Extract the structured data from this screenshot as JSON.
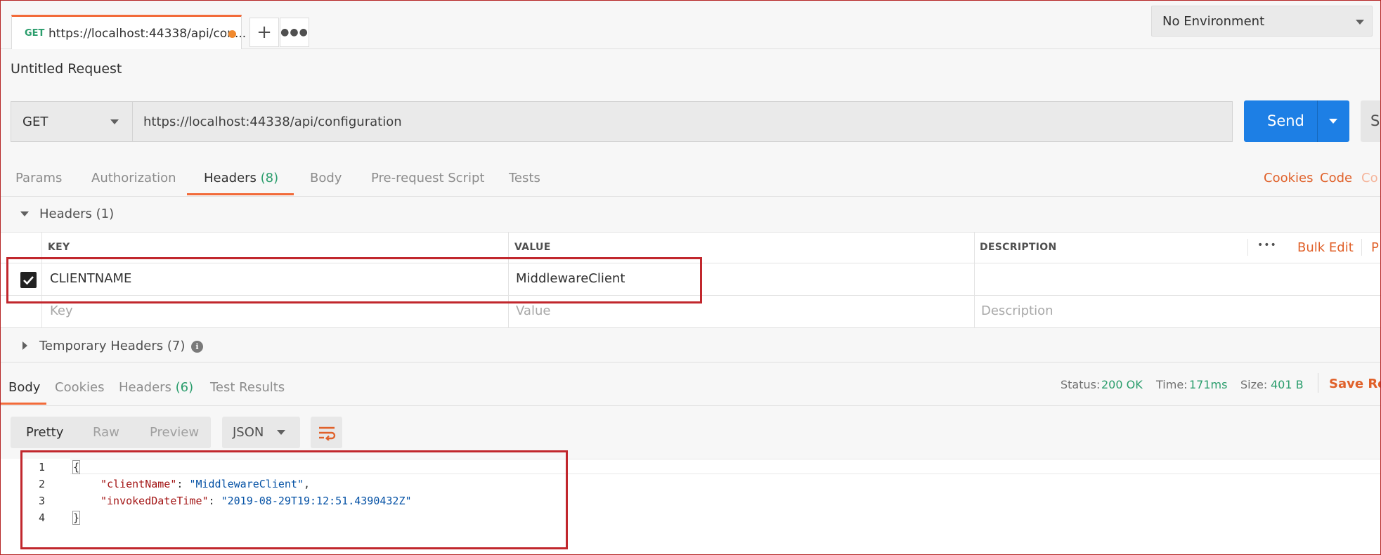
{
  "request_tab": {
    "method": "GET",
    "url": "https://localhost:44338/api/con..."
  },
  "environment": {
    "selected": "No Environment"
  },
  "request": {
    "title": "Untitled Request",
    "method": "GET",
    "url": "https://localhost:44338/api/configuration",
    "send_label": "Send",
    "save_label": "Sa"
  },
  "request_tabs": {
    "params": "Params",
    "authorization": "Authorization",
    "headers": "Headers",
    "headers_count": "(8)",
    "body": "Body",
    "pre_request": "Pre-request Script",
    "tests": "Tests",
    "cookies": "Cookies",
    "code": "Code",
    "comments": "Co"
  },
  "headers_section": {
    "title": "Headers",
    "count": "(1)",
    "col_key": "KEY",
    "col_value": "VALUE",
    "col_description": "DESCRIPTION",
    "more": "•••",
    "bulk_edit": "Bulk Edit",
    "presets": "P",
    "rows": [
      {
        "key": "CLIENTNAME",
        "value": "MiddlewareClient",
        "description": ""
      }
    ],
    "placeholder": {
      "key": "Key",
      "value": "Value",
      "description": "Description"
    }
  },
  "temporary_headers": {
    "title": "Temporary Headers",
    "count": "(7)",
    "info": "i"
  },
  "response": {
    "tabs": {
      "body": "Body",
      "cookies": "Cookies",
      "headers": "Headers",
      "headers_count": "(6)",
      "test_results": "Test Results"
    },
    "status_label": "Status:",
    "status_value": "200 OK",
    "time_label": "Time:",
    "time_value": "171ms",
    "size_label": "Size:",
    "size_value": "401 B",
    "save_response": "Save Res",
    "formats": {
      "pretty": "Pretty",
      "raw": "Raw",
      "preview": "Preview"
    },
    "language": "JSON",
    "code": {
      "line_numbers": [
        "1",
        "2",
        "3",
        "4"
      ],
      "open_brace": "{",
      "close_brace": "}",
      "key1": "\"clientName\"",
      "val1": "\"MiddlewareClient\"",
      "key2": "\"invokedDateTime\"",
      "val2": "\"2019-08-29T19:12:51.4390432Z\"",
      "colon": ": ",
      "comma": ","
    }
  },
  "colors": {
    "accent": "#f26b3a",
    "send": "#1d7fe5",
    "success": "#2a9d6c",
    "annotation": "#c1272d"
  }
}
